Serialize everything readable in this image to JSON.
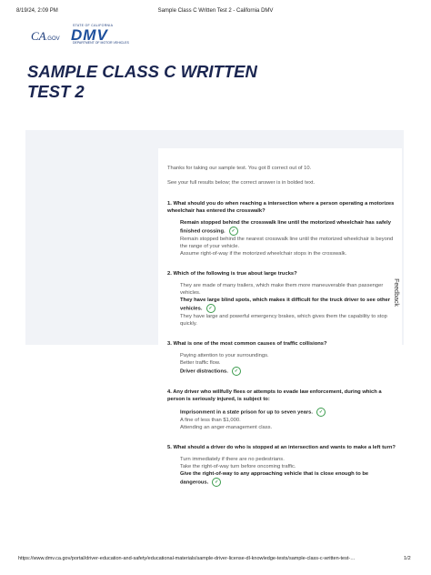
{
  "print_header": {
    "date": "8/19/24, 2:09 PM",
    "title": "Sample Class C Written Test 2 - California DMV"
  },
  "logos": {
    "cagov": "CA",
    "cagov_suffix": ".GOV",
    "dmv_top": "STATE OF CALIFORNIA",
    "dmv_main": "DMV",
    "dmv_bottom": "DEPARTMENT OF MOTOR VEHICLES"
  },
  "page": {
    "title_line1": "SAMPLE CLASS C WRITTEN",
    "title_line2": "TEST 2",
    "score_text": "Thanks for taking our sample test. You got 8 correct out of 10.",
    "results_note": "See your full results below; the correct answer is in bolded text.",
    "feedback_label": "Feedback"
  },
  "questions": [
    {
      "text": "1. What should you do when reaching a intersection where a person operating a motorizes wheelchair has entered the crosswalk?",
      "answers": [
        {
          "text": "Remain stopped behind the crosswalk line until the motorized wheelchair has safely finished crossing.",
          "correct": true
        },
        {
          "text": "Remain stopped behind the nearest crosswalk line until the motorized wheelchair is beyond the range of your vehicle.",
          "correct": false
        },
        {
          "text": "Assume right-of-way if the motorized wheelchair stops in the crosswalk.",
          "correct": false
        }
      ]
    },
    {
      "text": "2. Which of the following is true about large trucks?",
      "answers": [
        {
          "text": "They are made of many trailers, which make them more maneuverable than passenger vehicles.",
          "correct": false
        },
        {
          "text": "They have large blind spots, which makes it difficult for the truck driver to see other vehicles.",
          "correct": true
        },
        {
          "text": "They have large and powerful emergency brakes, which gives them the capability to stop quickly.",
          "correct": false
        }
      ]
    },
    {
      "text": "3. What is one of the most common causes of traffic collisions?",
      "answers": [
        {
          "text": "Paying attention to your surroundings.",
          "correct": false
        },
        {
          "text": "Better traffic flow.",
          "correct": false
        },
        {
          "text": "Driver distractions.",
          "correct": true
        }
      ]
    },
    {
      "text": "4. Any driver who willfully flees or attempts to evade law enforcement, during which a person is seriously injured, is subject to:",
      "answers": [
        {
          "text": "Imprisonment in a state prison for up to seven years.",
          "correct": true
        },
        {
          "text": "A fine of less than $1,000.",
          "correct": false
        },
        {
          "text": "Attending an anger-management class.",
          "correct": false
        }
      ]
    },
    {
      "text": "5. What should a driver do who is stopped at an intersection and wants to make a left turn?",
      "answers": [
        {
          "text": "Turn immediately if there are no pedestrians.",
          "correct": false
        },
        {
          "text": "Take the right-of-way turn before oncoming traffic.",
          "correct": false
        },
        {
          "text": "Give the right-of-way to any approaching vehicle that is close enough to be dangerous.",
          "correct": true
        }
      ]
    }
  ],
  "print_footer": {
    "url": "https://www.dmv.ca.gov/portal/driver-education-and-safety/educational-materials/sample-driver-license-dl-knowledge-tests/sample-class-c-written-test-…",
    "page_number": "1/2"
  }
}
